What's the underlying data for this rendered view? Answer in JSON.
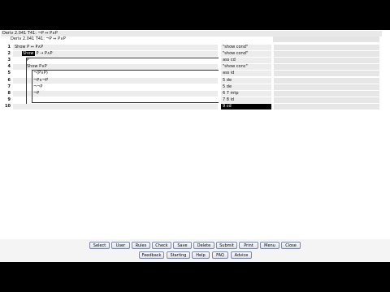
{
  "window": {
    "title": "Deriv 2.041 T41: ¬P ⇔ P∧P"
  },
  "proof": {
    "heading": "Deriv 2.041 T41: ¬P ⇔ P∧P",
    "rows": [
      {
        "num": "1",
        "text": "Show P ⇔ P∧P",
        "just": "\"show cond\""
      },
      {
        "num": "2",
        "text_pre": "",
        "highlight": "Show",
        "text": "P → P∧P",
        "just": "\"show cond\""
      },
      {
        "num": "3",
        "text": "P",
        "just": "ass cd"
      },
      {
        "num": "4",
        "text": "Show P∧P",
        "just": "\"show conc\""
      },
      {
        "num": "5",
        "text": "¬(P∧P)",
        "just": "ass id"
      },
      {
        "num": "6",
        "text": "¬P∨¬P",
        "just": "5 de"
      },
      {
        "num": "7",
        "text": "¬¬P",
        "just": "5 de"
      },
      {
        "num": "8",
        "text": "¬P",
        "just": "6 7 mtp"
      },
      {
        "num": "9",
        "text": "",
        "just": "7 8 id"
      },
      {
        "num": "10",
        "text": "",
        "just": "9 cd"
      }
    ]
  },
  "toolbar": {
    "row1": [
      "Select",
      "User",
      "Rules",
      "Check",
      "Save",
      "Delete",
      "Submit",
      "Print",
      "Menu",
      "Close"
    ],
    "row2": [
      "Feedback",
      "Starting",
      "Help",
      "FAQ",
      "Advice"
    ]
  }
}
